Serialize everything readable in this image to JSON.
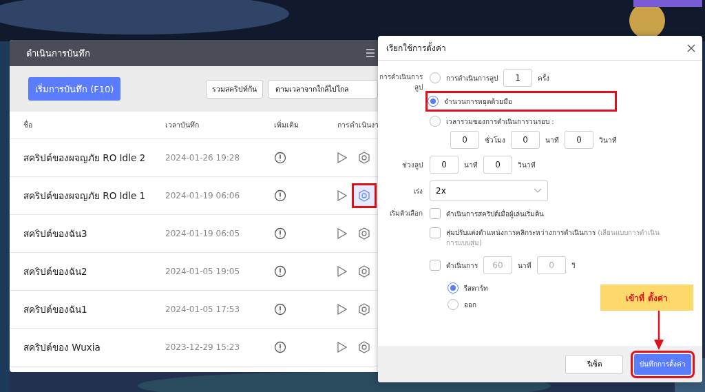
{
  "recorder": {
    "title": "ดำเนินการบันทึก",
    "record_button": "เริ่มการบันทึก (F10)",
    "merge_button": "รวมสคริปท์กัน",
    "sort_select": "ตามเวลาจากใกล้ไปไกล",
    "columns": [
      "ชื่อ",
      "เวลาบันทึก",
      "เพิ่มเติม",
      "การดำเนินงา"
    ],
    "rows": [
      {
        "name": "สคริปต์ของผจญภัย RO Idle 2",
        "time": "2024-01-26 19:28",
        "settings_active": false,
        "outlined": false
      },
      {
        "name": "สคริปต์ของผจญภัย RO Idle 1",
        "time": "2024-01-19 06:06",
        "settings_active": true,
        "outlined": true
      },
      {
        "name": "สคริปต์ของฉัน3",
        "time": "2024-01-19 06:05",
        "settings_active": false,
        "outlined": false
      },
      {
        "name": "สคริปต์ของฉัน2",
        "time": "2024-01-05 19:05",
        "settings_active": false,
        "outlined": false
      },
      {
        "name": "สคริปต์ของฉัน1",
        "time": "2024-01-05 17:53",
        "settings_active": false,
        "outlined": false
      },
      {
        "name": "สคริปต์ของ Wuxia",
        "time": "2023-12-29 15:23",
        "settings_active": false,
        "outlined": false
      }
    ]
  },
  "dialog": {
    "title": "เรียกใช้การตั้งค่า",
    "loop_label": "การดำเนินการลูป",
    "loop_options": [
      {
        "kind": "count",
        "label": "การดำเนินการลูป",
        "value": "1",
        "unit": "ครั้ง",
        "selected": false,
        "outlined": false
      },
      {
        "kind": "plain",
        "label": "จำนวนการหยุดด้วยมือ",
        "selected": true,
        "outlined": true
      },
      {
        "kind": "duration",
        "label": "เวลารวมของการดำเนินการวนรอบ :",
        "fields": [
          {
            "value": "0",
            "unit": "ชั่วโมง"
          },
          {
            "value": "0",
            "unit": "นาที"
          },
          {
            "value": "0",
            "unit": "วินาที"
          }
        ],
        "selected": false,
        "outlined": false
      }
    ],
    "interval_label": "ช่วงลูป",
    "interval_fields": [
      {
        "value": "0",
        "unit": "นาที"
      },
      {
        "value": "0",
        "unit": "วินาที"
      }
    ],
    "speed_label": "เร่ง",
    "speed_value": "2x",
    "start_label": "เริ่มตัวเลือก",
    "start_options": [
      {
        "kind": "plain",
        "label": "ดำเนินการสคริปต์เมื่อผู้เล่นเริ่มต้น",
        "checked": false
      },
      {
        "kind": "note",
        "label": "สุ่มปรับแต่งตำแหน่งการคลิกระหว่างการดำเนินการ",
        "note": "(เลียนแบบการดำเนินการแบบสุ่ม)",
        "checked": false
      },
      {
        "kind": "timer",
        "label": "ดำเนินการ",
        "fields": [
          {
            "value": "60",
            "unit": "นาที"
          },
          {
            "value": "0",
            "unit": "วิ"
          }
        ],
        "checked": false
      }
    ],
    "after_options": [
      {
        "label": "รีสตาร์ท",
        "selected": true
      },
      {
        "label": "ออก",
        "selected": false
      }
    ],
    "reset_button": "รีเซ็ต",
    "save_button": "บันทึกการตั้งค่า",
    "save_outlined": true
  },
  "callout": {
    "text": "เข้าที่ ตั้งค่า"
  }
}
